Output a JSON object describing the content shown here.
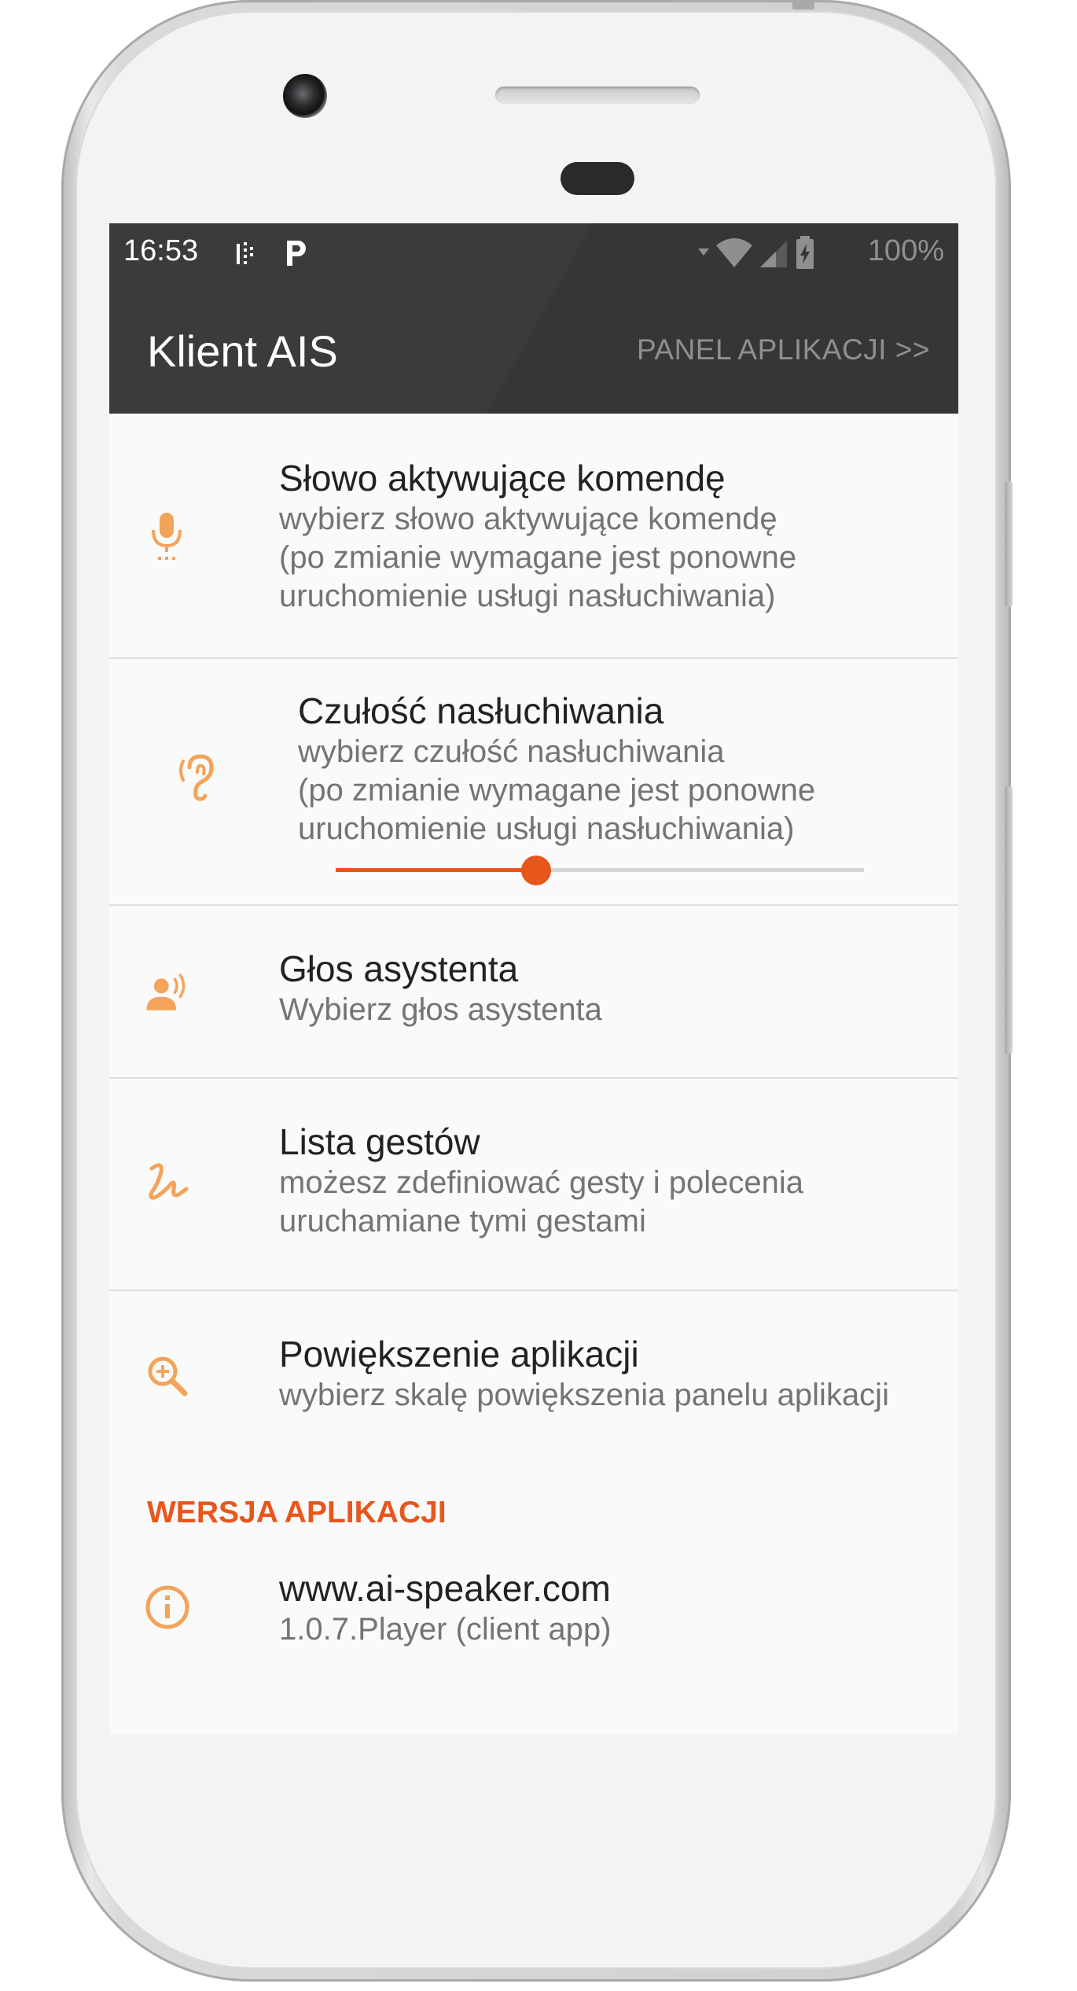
{
  "status_bar": {
    "time": "16:53",
    "battery": "100%",
    "icons": [
      "notification-icon",
      "parking-icon",
      "wifi-icon",
      "signal-icon",
      "battery-charging-icon"
    ]
  },
  "toolbar": {
    "title": "Klient AIS",
    "panel_button": "PANEL APLIKACJI >>"
  },
  "settings": [
    {
      "title": "Słowo aktywujące komendę",
      "summary": [
        "wybierz słowo aktywujące komendę",
        "(po zmianie wymagane jest ponowne",
        "uruchomienie usługi nasłuchiwania)"
      ],
      "icon": "microphone-icon"
    },
    {
      "title": "Czułość nasłuchiwania",
      "summary": [
        "wybierz czułość nasłuchiwania",
        "(po zmianie wymagane jest ponowne",
        "uruchomienie usługi nasłuchiwania)"
      ],
      "icon": "ear-icon",
      "slider_fraction": 0.38
    },
    {
      "title": "Głos asystenta",
      "summary": [
        "Wybierz głos asystenta"
      ],
      "icon": "voice-icon"
    },
    {
      "title": "Lista gestów",
      "summary": [
        "możesz zdefiniować gesty i polecenia",
        "uruchamiane tymi gestami"
      ],
      "icon": "gesture-icon"
    },
    {
      "title": "Powiększenie aplikacji",
      "summary": [
        "wybierz skalę powiększenia panelu aplikacji"
      ],
      "icon": "zoom-in-icon"
    }
  ],
  "version_section": {
    "header": "WERSJA APLIKACJI",
    "title": "www.ai-speaker.com",
    "summary": "1.0.7.Player (client app)",
    "icon": "info-icon"
  },
  "colors": {
    "accent": "#e8561c",
    "icon": "#f4a35a",
    "toolbar": "#3b3b3b"
  }
}
